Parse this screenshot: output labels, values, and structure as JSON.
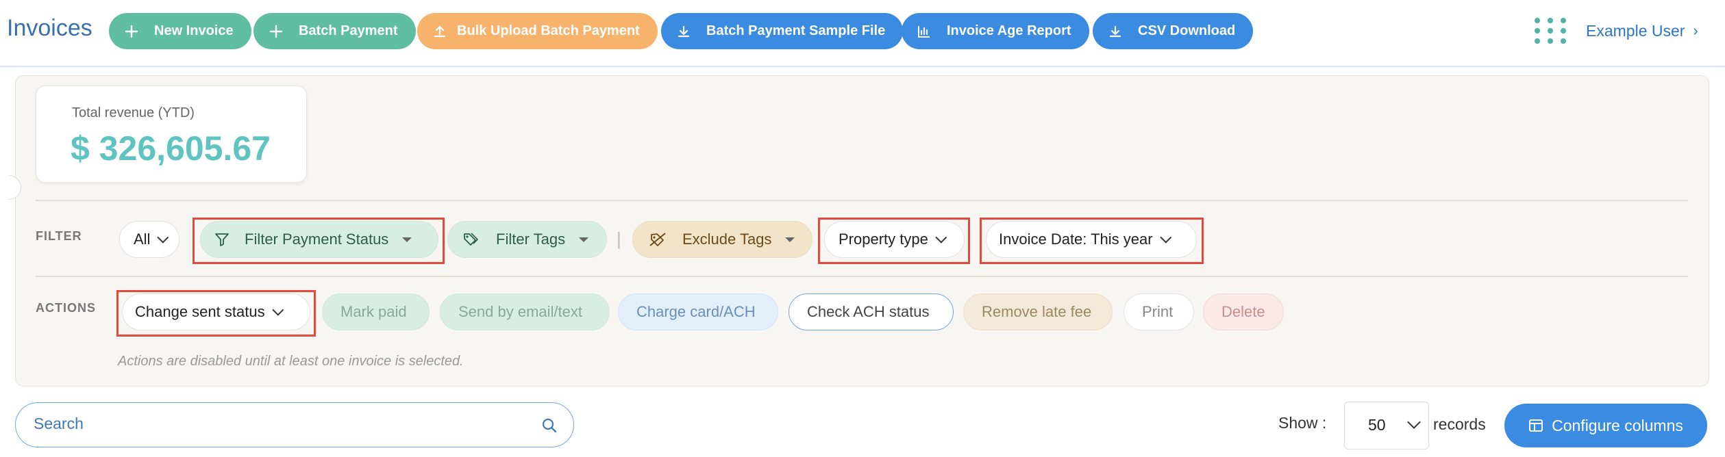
{
  "header": {
    "title": "Invoices",
    "buttons": {
      "new_invoice": "New Invoice",
      "batch_payment": "Batch Payment",
      "bulk_upload": "Bulk Upload Batch Payment",
      "sample_file": "Batch Payment Sample File",
      "age_report": "Invoice Age Report",
      "csv_download": "CSV Download"
    },
    "user_name": "Example User"
  },
  "colors": {
    "green": "#5fbe9f",
    "orange": "#f7b36b",
    "blue": "#3b8be0",
    "revenue_teal": "#5fc3c0",
    "highlight_red": "#e24b3b"
  },
  "revenue": {
    "label": "Total revenue (YTD)",
    "value": "$ 326,605.67"
  },
  "filter": {
    "label": "FILTER",
    "all": "All",
    "payment_status": "Filter Payment Status",
    "tags": "Filter Tags",
    "separator": "|",
    "exclude_tags": "Exclude Tags",
    "property_type": "Property type",
    "invoice_date": "Invoice Date: This year"
  },
  "actions": {
    "label": "ACTIONS",
    "change_sent_status": "Change sent status",
    "mark_paid": "Mark paid",
    "send_email": "Send by email/text",
    "charge_card": "Charge card/ACH",
    "check_ach": "Check ACH status",
    "remove_late_fee": "Remove late fee",
    "print": "Print",
    "delete": "Delete",
    "note": "Actions are disabled until at least one invoice is selected."
  },
  "bottom": {
    "search_placeholder": "Search",
    "show_label": "Show :",
    "records_value": "50",
    "records_label": "records",
    "configure_columns": "Configure columns"
  }
}
